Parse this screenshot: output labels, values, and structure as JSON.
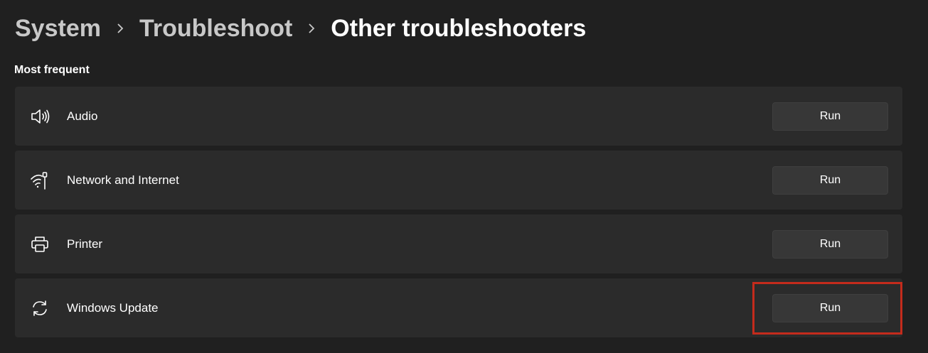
{
  "breadcrumb": {
    "items": [
      "System",
      "Troubleshoot",
      "Other troubleshooters"
    ],
    "separator_icon": "chevron-right-icon"
  },
  "section": {
    "title": "Most frequent"
  },
  "troubleshooters": [
    {
      "label": "Audio",
      "icon": "speaker-icon",
      "button": "Run"
    },
    {
      "label": "Network and Internet",
      "icon": "network-icon",
      "button": "Run"
    },
    {
      "label": "Printer",
      "icon": "printer-icon",
      "button": "Run"
    },
    {
      "label": "Windows Update",
      "icon": "sync-icon",
      "button": "Run"
    }
  ],
  "colors": {
    "background": "#202020",
    "card": "#2b2b2b",
    "button": "#373737",
    "highlight": "#c42b1c"
  }
}
